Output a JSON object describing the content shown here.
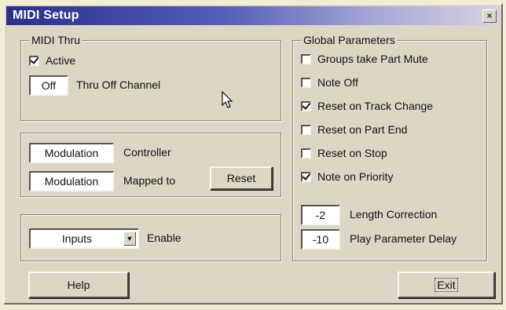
{
  "window": {
    "title": "MIDI Setup",
    "close_symbol": "×"
  },
  "midi_thru": {
    "legend": "MIDI Thru",
    "active": {
      "label": "Active",
      "checked": true
    },
    "channel_value": "Off",
    "channel_label": "Thru Off Channel"
  },
  "controller": {
    "controller_value": "Modulation",
    "controller_label": "Controller",
    "mapped_value": "Modulation",
    "mapped_label": "Mapped to",
    "reset_label": "Reset"
  },
  "inputs": {
    "selected": "Inputs",
    "enable_label": "Enable"
  },
  "global": {
    "legend": "Global Parameters",
    "options": [
      {
        "label": "Groups take Part Mute",
        "checked": false
      },
      {
        "label": "Note Off",
        "checked": false
      },
      {
        "label": "Reset on Track Change",
        "checked": true
      },
      {
        "label": "Reset on Part End",
        "checked": false
      },
      {
        "label": "Reset on Stop",
        "checked": false
      },
      {
        "label": "Note on Priority",
        "checked": true
      }
    ],
    "length_correction_value": "-2",
    "length_correction_label": "Length Correction",
    "play_delay_value": "-10",
    "play_delay_label": "Play Parameter Delay"
  },
  "buttons": {
    "help": "Help",
    "exit": "Exit"
  }
}
